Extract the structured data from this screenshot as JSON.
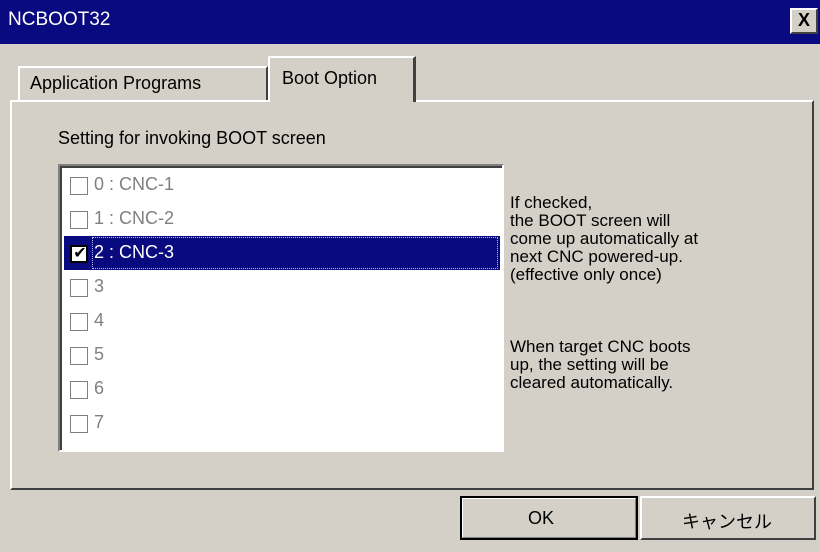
{
  "window": {
    "title": "NCBOOT32",
    "close_label": "X"
  },
  "tabs": [
    {
      "label": "Application Programs",
      "active": false
    },
    {
      "label": "Boot Option",
      "active": true
    }
  ],
  "boot_option": {
    "caption": "Setting for invoking BOOT screen",
    "items": [
      {
        "label": "0 : CNC-1",
        "checked": false
      },
      {
        "label": "1 : CNC-2",
        "checked": false
      },
      {
        "label": "2 : CNC-3",
        "checked": true
      },
      {
        "label": "3",
        "checked": false
      },
      {
        "label": "4",
        "checked": false
      },
      {
        "label": "5",
        "checked": false
      },
      {
        "label": "6",
        "checked": false
      },
      {
        "label": "7",
        "checked": false
      }
    ],
    "info_lines_1": [
      "If checked,",
      "the BOOT screen will",
      "come up automatically at",
      "next CNC powered-up.",
      "(effective only once)"
    ],
    "info_lines_2": [
      "When target CNC boots",
      "up, the setting will be",
      "cleared automatically."
    ]
  },
  "buttons": {
    "ok": "OK",
    "cancel": "キャンセル"
  },
  "colors": {
    "titlebar": "#0a0a80",
    "face": "#d4d0c8",
    "selection": "#0a0a80"
  }
}
